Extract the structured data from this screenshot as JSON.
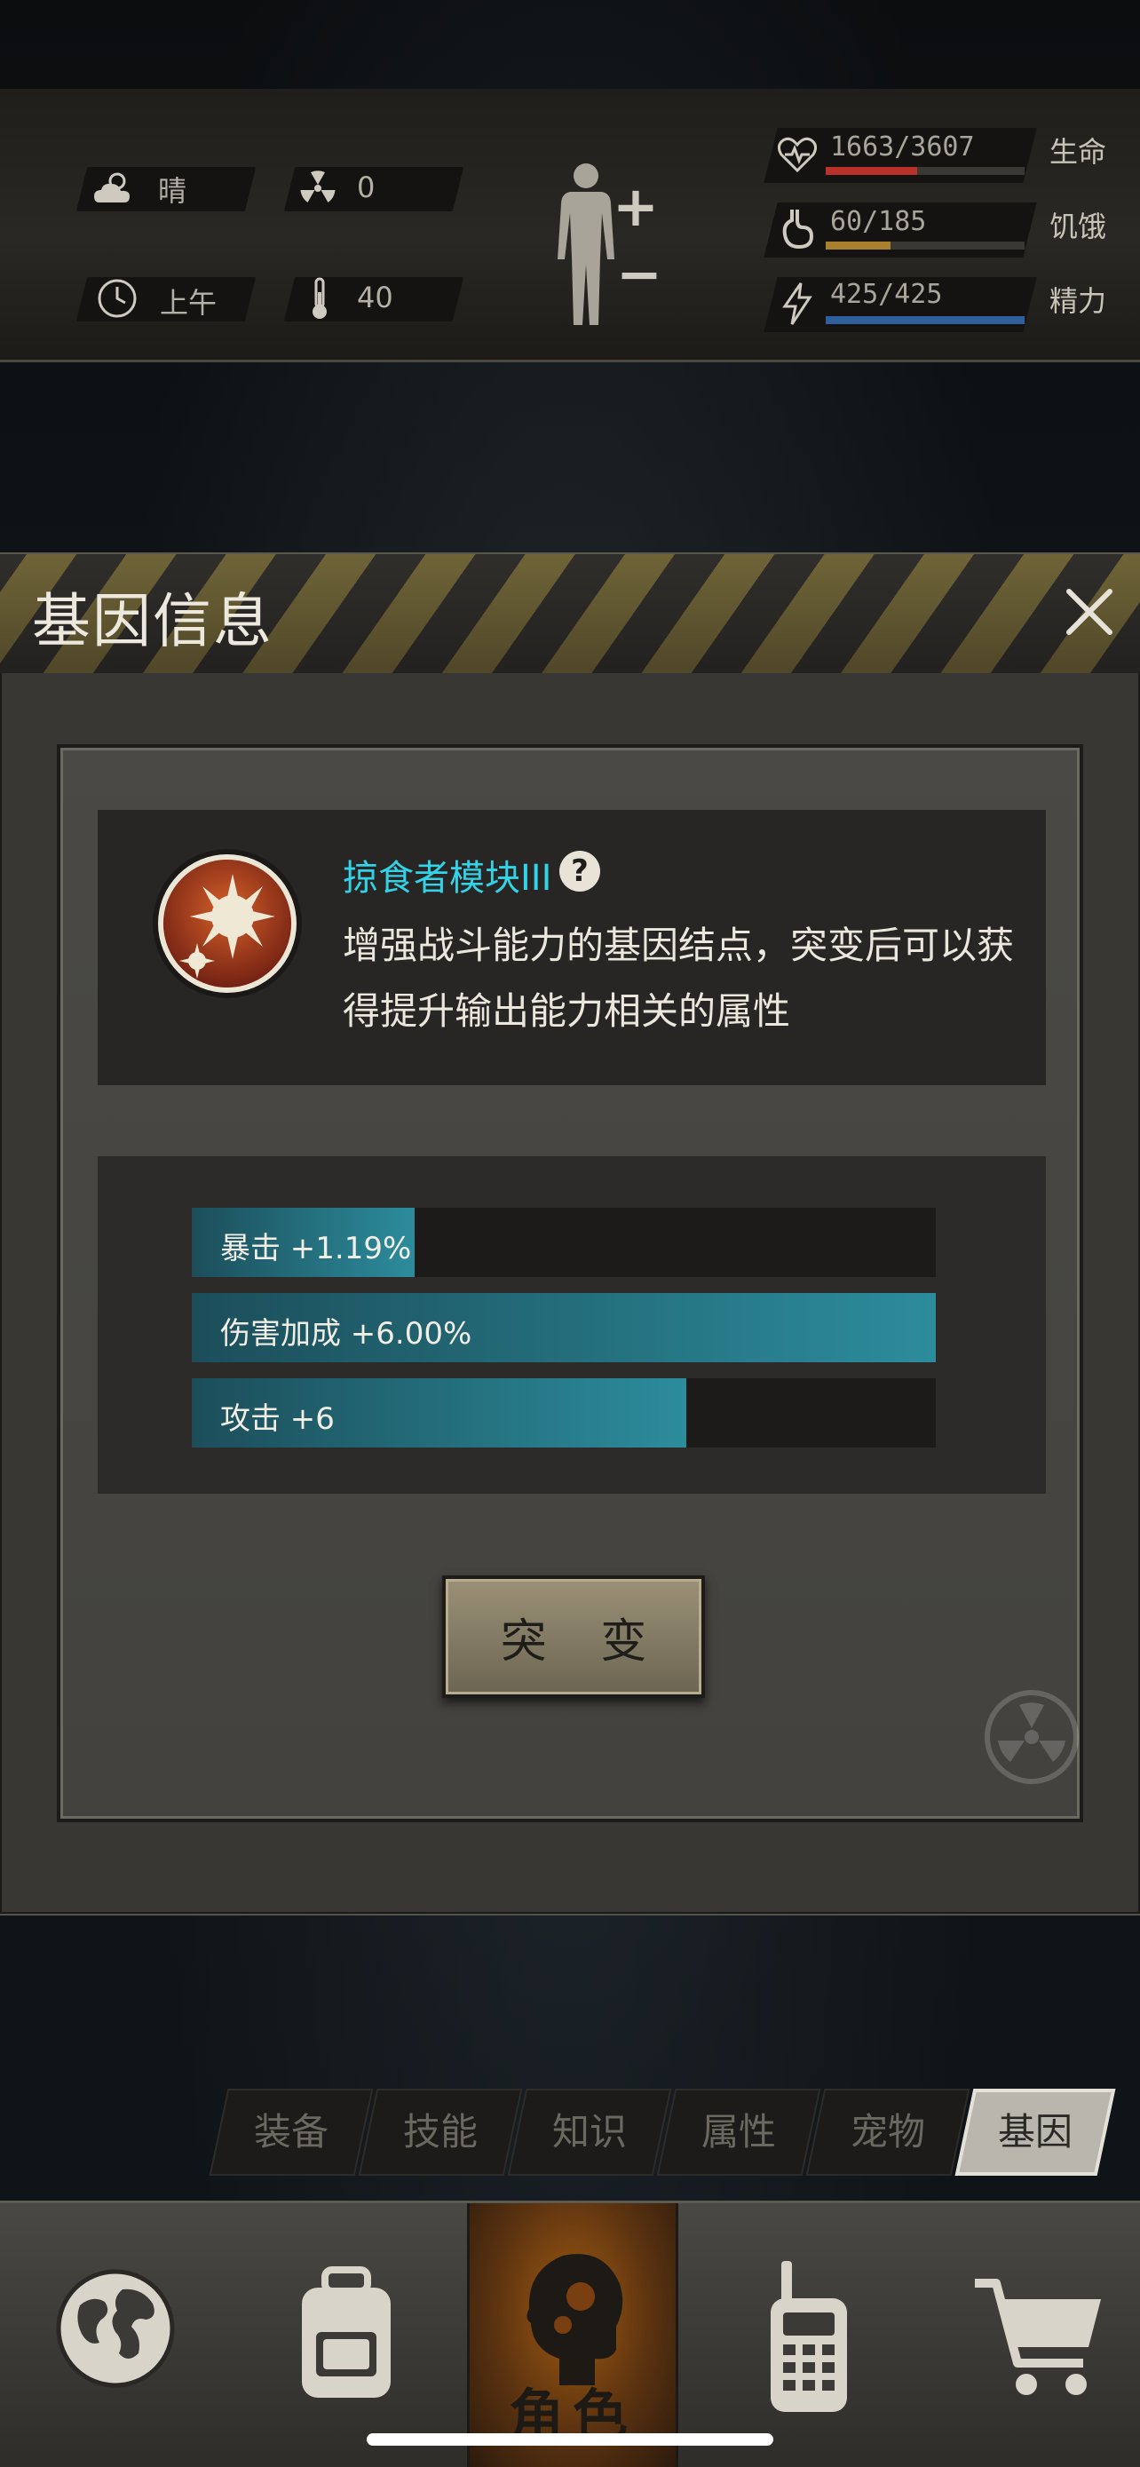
{
  "hud": {
    "weather": "晴",
    "radiation": "0",
    "time_of_day": "上午",
    "temperature": "40",
    "stats": [
      {
        "key": "health",
        "value": "1663/3607",
        "label": "生命",
        "fraction": 0.461,
        "color": "#b8322a",
        "icon": "heart-icon"
      },
      {
        "key": "hunger",
        "value": "60/185",
        "label": "饥饿",
        "fraction": 0.324,
        "color": "#a8802e",
        "icon": "stomach-icon"
      },
      {
        "key": "energy",
        "value": "425/425",
        "label": "精力",
        "fraction": 1.0,
        "color": "#2f5f9c",
        "icon": "lightning-icon"
      }
    ]
  },
  "dialog": {
    "title": "基因信息",
    "gene": {
      "name": "掠食者模块III",
      "description": "增强战斗能力的基因结点，突变后可以获得提升输出能力相关的属性"
    },
    "bonuses": [
      {
        "text": "暴击 +1.19%",
        "fraction": 0.3
      },
      {
        "text": "伤害加成 +6.00%",
        "fraction": 1.0
      },
      {
        "text": "攻击 +6",
        "fraction": 0.665
      }
    ],
    "mutate_label": "突 变"
  },
  "tabs": [
    {
      "label": "装备",
      "active": false
    },
    {
      "label": "技能",
      "active": false
    },
    {
      "label": "知识",
      "active": false
    },
    {
      "label": "属性",
      "active": false
    },
    {
      "label": "宠物",
      "active": false
    },
    {
      "label": "基因",
      "active": true
    }
  ],
  "nav": [
    {
      "key": "world",
      "icon": "globe-icon"
    },
    {
      "key": "inventory",
      "icon": "backpack-icon"
    },
    {
      "key": "character",
      "icon": "character-head-icon",
      "label": "角色",
      "active": true
    },
    {
      "key": "radio",
      "icon": "walkie-talkie-icon"
    },
    {
      "key": "shop",
      "icon": "shopping-cart-icon"
    }
  ],
  "colors": {
    "accent_cyan": "#33d2e6",
    "bar_teal": "#2c8c9c",
    "hazard_yellow": "#8b7b3a"
  }
}
